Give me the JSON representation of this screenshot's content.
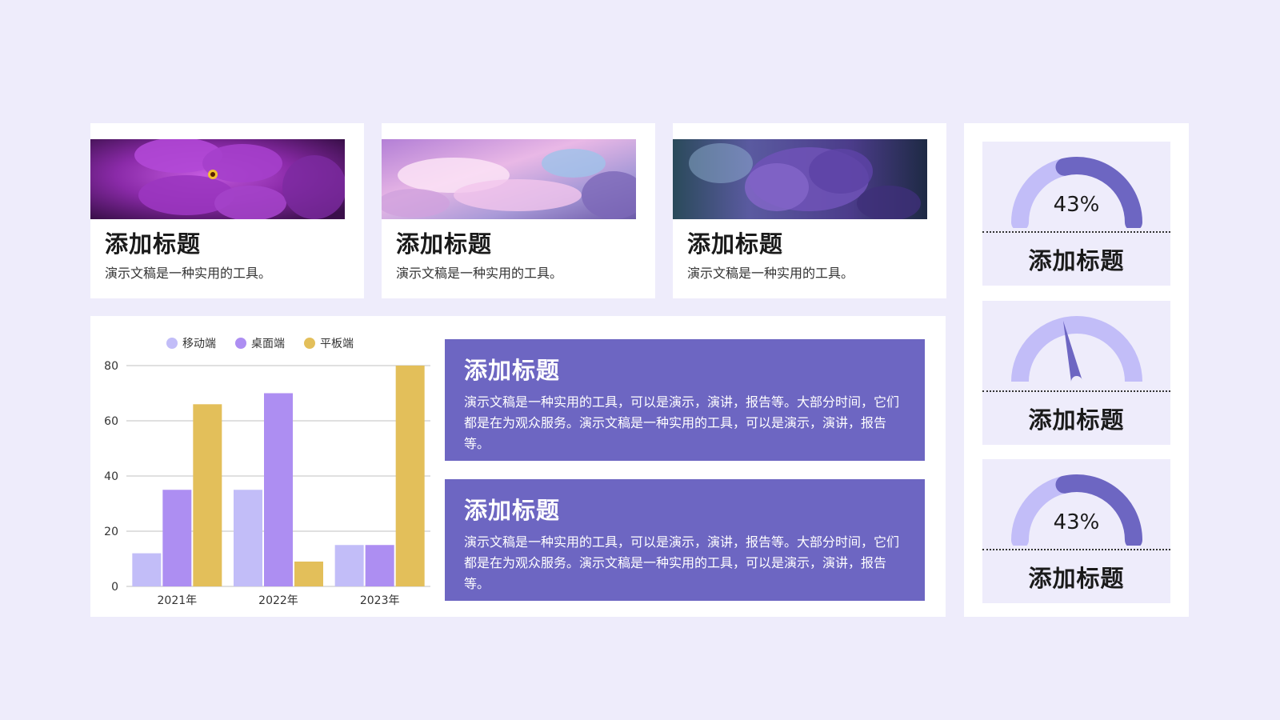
{
  "cards": [
    {
      "title": "添加标题",
      "text": "演示文稿是一种实用的工具。",
      "image": "purple-flower-photo"
    },
    {
      "title": "添加标题",
      "text": "演示文稿是一种实用的工具。",
      "image": "pink-clouds-photo"
    },
    {
      "title": "添加标题",
      "text": "演示文稿是一种实用的工具。",
      "image": "lilac-blossom-photo"
    }
  ],
  "info_boxes": [
    {
      "title": "添加标题",
      "text": "演示文稿是一种实用的工具，可以是演示，演讲，报告等。大部分时间，它们都是在为观众服务。演示文稿是一种实用的工具，可以是演示，演讲，报告等。"
    },
    {
      "title": "添加标题",
      "text": "演示文稿是一种实用的工具，可以是演示，演讲，报告等。大部分时间，它们都是在为观众服务。演示文稿是一种实用的工具，可以是演示，演讲，报告等。"
    }
  ],
  "gauges": [
    {
      "value_label": "43%",
      "value": 0.43,
      "style": "progress-arc",
      "title": "添加标题"
    },
    {
      "value_label": "",
      "value": 0.43,
      "style": "needle",
      "title": "添加标题"
    },
    {
      "value_label": "43%",
      "value": 0.43,
      "style": "progress-arc",
      "title": "添加标题"
    }
  ],
  "colors": {
    "background": "#eeecfb",
    "accent": "#6d66c2",
    "gauge_track": "#c2bdf8",
    "gauge_fill": "#6d66c2",
    "series_mobile": "#c2bdf8",
    "series_desktop": "#ad8ef2",
    "series_tablet": "#e3bf5a"
  },
  "chart_data": {
    "type": "bar",
    "categories": [
      "2021年",
      "2022年",
      "2023年"
    ],
    "series": [
      {
        "name": "移动端",
        "values": [
          12,
          35,
          15
        ],
        "color": "#c2bdf8"
      },
      {
        "name": "桌面端",
        "values": [
          35,
          70,
          15
        ],
        "color": "#ad8ef2"
      },
      {
        "name": "平板端",
        "values": [
          66,
          9,
          80
        ],
        "color": "#e3bf5a"
      }
    ],
    "yticks": [
      "0",
      "20",
      "40",
      "60",
      "80"
    ],
    "ylim": [
      0,
      80
    ],
    "grid": true,
    "legend": "top"
  }
}
